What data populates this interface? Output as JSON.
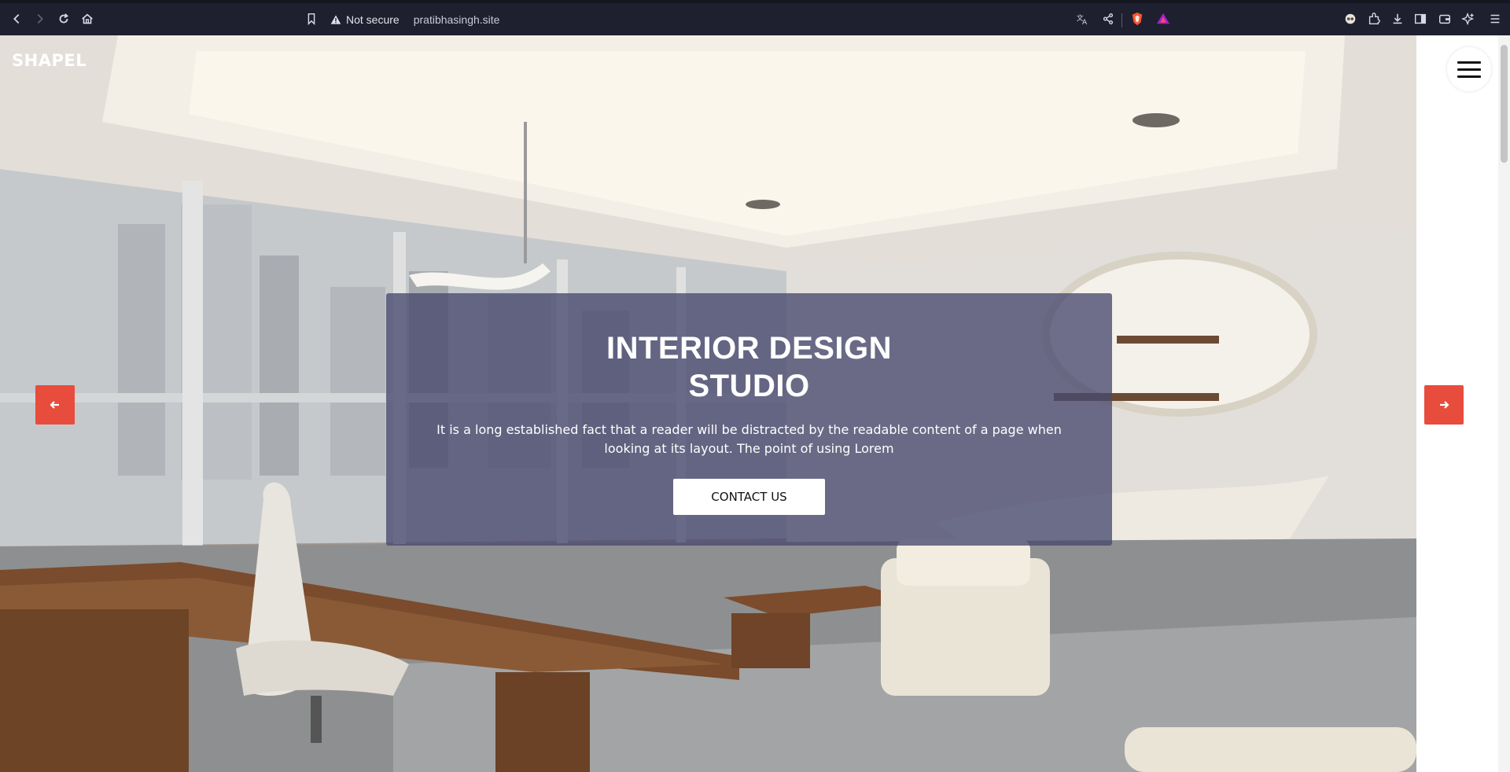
{
  "browser": {
    "security_label": "Not secure",
    "url": "pratibhasingh.site",
    "icons": [
      "back-icon",
      "forward-icon",
      "reload-icon",
      "home-icon",
      "bookmark-icon",
      "warning-icon",
      "translate-icon",
      "share-icon",
      "brave-shields-icon",
      "brave-rewards-icon",
      "vpn-icon",
      "extensions-icon",
      "download-icon",
      "sidebar-icon",
      "wallet-icon",
      "leo-ai-icon",
      "menu-icon"
    ]
  },
  "site": {
    "logo": "SHAPEL",
    "hero": {
      "title_line1": "INTERIOR DESIGN",
      "title_line2": "STUDIO",
      "description": "It is a long established fact that a reader will be distracted by the readable content of a page when looking at its layout. The point of using Lorem",
      "cta_label": "CONTACT US"
    },
    "colors": {
      "accent": "#e74c3c",
      "caption_bg": "#48496e"
    }
  }
}
